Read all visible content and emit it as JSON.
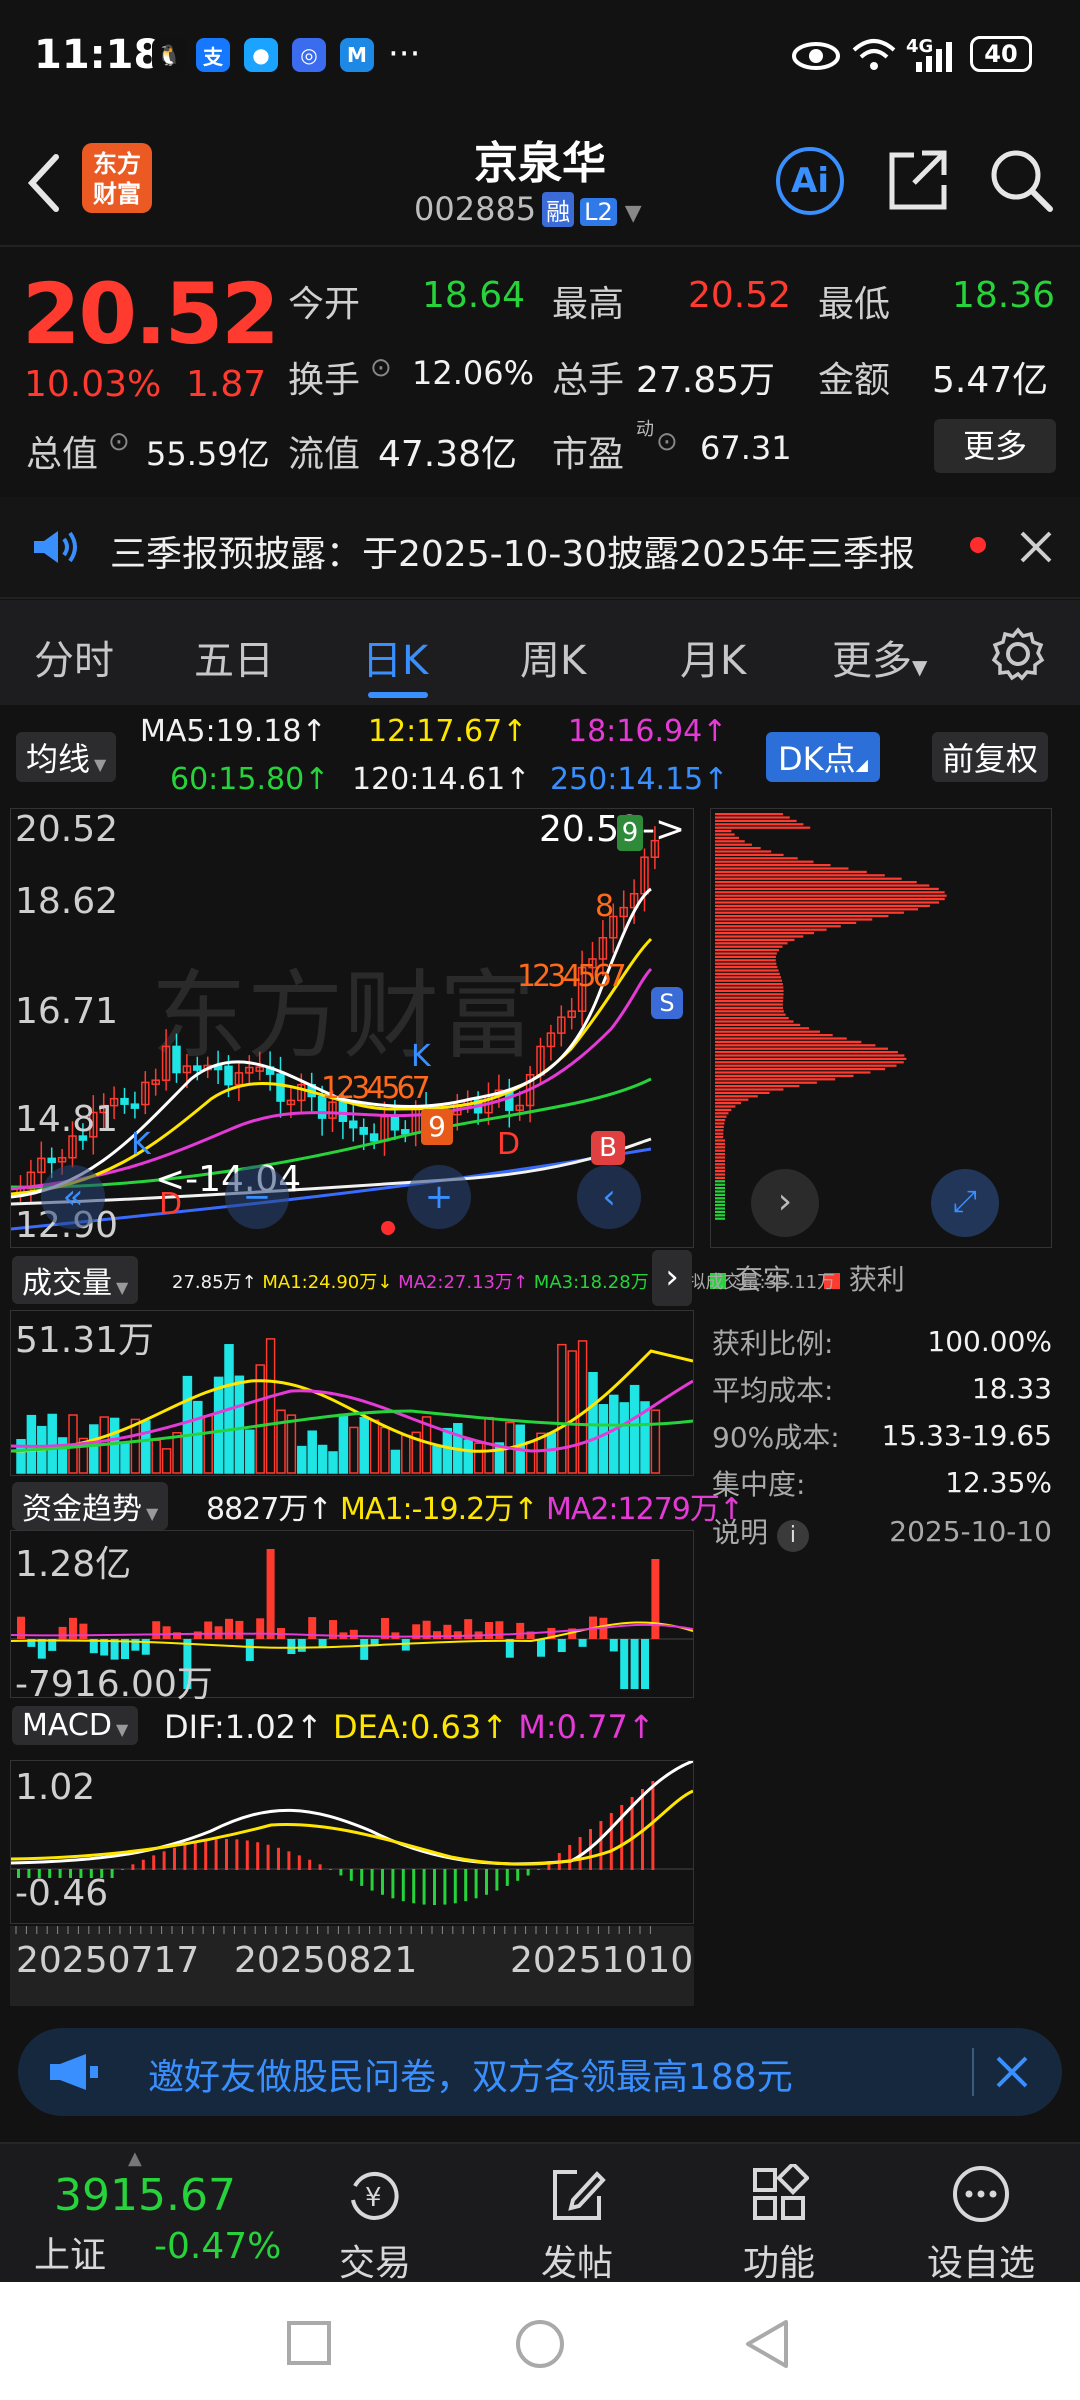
{
  "status": {
    "time": "11:18",
    "battery": "40",
    "network": "4G",
    "more": "···"
  },
  "header": {
    "logo": "东方财富",
    "name": "京泉华",
    "code": "002885",
    "tag_rong": "融",
    "tag_l2": "L2",
    "ai_label": "Ai"
  },
  "quote": {
    "price": "20.52",
    "pct": "10.03%",
    "change": "1.87",
    "open_label": "今开",
    "open": "18.64",
    "high_label": "最高",
    "high": "20.52",
    "low_label": "最低",
    "low": "18.36",
    "turnover_label": "换手",
    "turnover": "12.06%",
    "volume_label": "总手",
    "volume": "27.85万",
    "amount_label": "金额",
    "amount": "5.47亿",
    "mcap_label": "总值",
    "mcap": "55.59亿",
    "float_label": "流值",
    "float": "47.38亿",
    "pe_label": "市盈",
    "pe_sup": "动",
    "pe": "67.31",
    "more": "更多"
  },
  "notice": {
    "text": "三季报预披露：于2025-10-30披露2025年三季报"
  },
  "tabs": [
    "分时",
    "五日",
    "日K",
    "周K",
    "月K",
    "更多"
  ],
  "kline": {
    "ma_label": "均线",
    "ma5": "MA5:19.18↑",
    "ma12": "12:17.67↑",
    "ma18": "18:16.94↑",
    "ma60": "60:15.80↑",
    "ma120": "120:14.61↑",
    "ma250": "250:14.15↑",
    "dk_label": "DK点",
    "adjust_label": "前复权",
    "y_labels": [
      "20.52",
      "18.62",
      "16.71",
      "14.81",
      "12.90"
    ],
    "max_marker": "20.52->",
    "min_marker": "<-14.04",
    "watermark": "东方财富",
    "signals": [
      "K",
      "K",
      "D",
      "D",
      "B",
      "S"
    ],
    "counts_down": [
      "1",
      "2",
      "3",
      "4",
      "5",
      "6",
      "7"
    ],
    "counts_up": [
      "1",
      "2",
      "3",
      "4",
      "5",
      "6",
      "7",
      "8",
      "9"
    ],
    "count_nine": "9"
  },
  "chip": {
    "legend_trapped": "套牢",
    "legend_profit": "获利",
    "rows": [
      {
        "label": "获利比例:",
        "value": "100.00%"
      },
      {
        "label": "平均成本:",
        "value": "18.33"
      },
      {
        "label": "90%成本:",
        "value": "15.33-19.65"
      },
      {
        "label": "集中度:",
        "value": "12.35%"
      }
    ],
    "note_label": "说明",
    "date": "2025-10-10"
  },
  "volume": {
    "label": "成交量",
    "legend": [
      "27.85万↑",
      "MA1:24.90万↓",
      "MA2:27.13万↑",
      "MA3:18.28万↑",
      "虚拟成交量:35.11万"
    ],
    "y_max": "51.31万"
  },
  "fund": {
    "label": "资金趋势",
    "value": "8827万↑",
    "ma1": "MA1:-19.2万↑",
    "ma2": "MA2:1279万↑",
    "y_max": "1.28亿",
    "y_min": "-7916.00万"
  },
  "macd": {
    "label": "MACD",
    "dif": "DIF:1.02↑",
    "dea": "DEA:0.63↑",
    "m": "M:0.77↑",
    "y_max": "1.02",
    "y_min": "-0.46"
  },
  "dates": [
    "20250717",
    "20250821",
    "20251010"
  ],
  "invite": {
    "text": "邀好友做股民问卷，双方各领最高188元"
  },
  "bottom_nav": {
    "index_value": "3915.67",
    "index_name": "上证",
    "index_change": "-0.47%",
    "items": [
      "交易",
      "发帖",
      "功能",
      "设自选"
    ]
  },
  "colors": {
    "up": "#ff3b30",
    "down": "#27d33a",
    "accent": "#3a8fff",
    "ma5": "#ffffff",
    "ma12": "#ffe600",
    "ma18": "#e43ad6",
    "ma60": "#27d33a",
    "ma120": "#f2f2f2",
    "ma250": "#3a6bff",
    "volume_down": "#1fe5e5"
  }
}
